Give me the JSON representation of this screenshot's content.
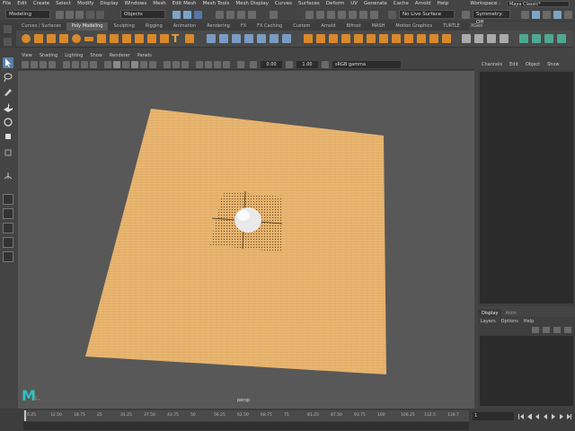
{
  "menu": {
    "items": [
      "File",
      "Edit",
      "Create",
      "Select",
      "Modify",
      "Display",
      "Windows",
      "Mesh",
      "Edit Mesh",
      "Mesh Tools",
      "Mesh Display",
      "Curves",
      "Surfaces",
      "Deform",
      "UV",
      "Generate",
      "Cache",
      "Arnold",
      "Help"
    ],
    "workspace_label": "Workspace :",
    "workspace_value": "Maya Classic*"
  },
  "status": {
    "mode": "Modeling",
    "objects": "Objects",
    "live_surface": "No Live Surface",
    "symmetry": "Symmetry: Off"
  },
  "shelf": {
    "tabs": [
      "Curves / Surfaces",
      "Poly Modeling",
      "Sculpting",
      "Rigging",
      "Animation",
      "Rendering",
      "FX",
      "FX Caching",
      "Custom",
      "Arnold",
      "Bifrost",
      "MASH",
      "Motion Graphics",
      "TURTLE",
      "XGen"
    ],
    "active": "Poly Modeling"
  },
  "viewport": {
    "menu": [
      "View",
      "Shading",
      "Lighting",
      "Show",
      "Renderer",
      "Panels"
    ],
    "field_a": "0.00",
    "field_b": "1.00",
    "color_space": "sRGB gamma",
    "camera": "persp"
  },
  "channel_box": {
    "menu": [
      "Channels",
      "Edit",
      "Object",
      "Show"
    ]
  },
  "layer_editor": {
    "tabs": [
      "Display",
      "Anim"
    ],
    "menu": [
      "Layers",
      "Options",
      "Help"
    ]
  },
  "timeline": {
    "ticks": [
      "6.25",
      "12.50",
      "18.75",
      "25",
      "31.25",
      "37.50",
      "43.75",
      "50",
      "56.25",
      "62.50",
      "68.75",
      "75",
      "81.25",
      "87.50",
      "93.75",
      "100",
      "106.25",
      "112.5",
      "118.7"
    ],
    "current_frame": "1"
  },
  "colors": {
    "accent_orange": "#d9882b",
    "plane_wood": "#e8b46e",
    "viewport_bg": "#585858",
    "maya_logo": "#2fc1c4"
  }
}
